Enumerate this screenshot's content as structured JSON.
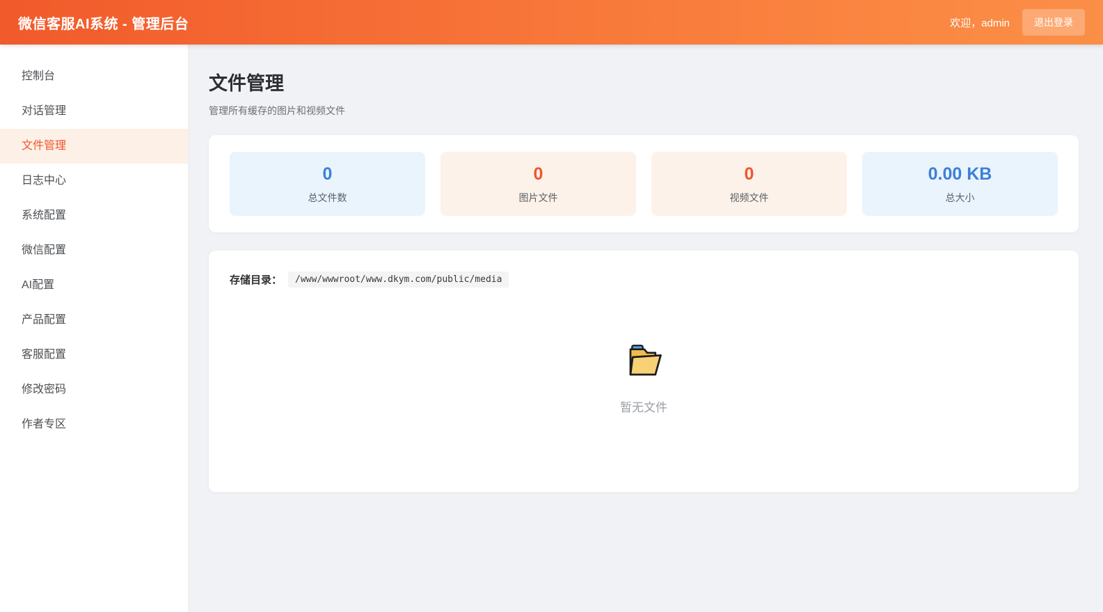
{
  "header": {
    "title": "微信客服AI系统 - 管理后台",
    "welcome": "欢迎，admin",
    "logout_label": "退出登录"
  },
  "sidebar": {
    "items": [
      {
        "label": "控制台",
        "active": false
      },
      {
        "label": "对话管理",
        "active": false
      },
      {
        "label": "文件管理",
        "active": true
      },
      {
        "label": "日志中心",
        "active": false
      },
      {
        "label": "系统配置",
        "active": false
      },
      {
        "label": "微信配置",
        "active": false
      },
      {
        "label": "AI配置",
        "active": false
      },
      {
        "label": "产品配置",
        "active": false
      },
      {
        "label": "客服配置",
        "active": false
      },
      {
        "label": "修改密码",
        "active": false
      },
      {
        "label": "作者专区",
        "active": false
      }
    ]
  },
  "page": {
    "title": "文件管理",
    "subtitle": "管理所有缓存的图片和视频文件"
  },
  "stats": [
    {
      "value": "0",
      "label": "总文件数",
      "theme": "blue",
      "value_color": "#3d7fd8",
      "bg_color": "#eaf4fd"
    },
    {
      "value": "0",
      "label": "图片文件",
      "theme": "orange",
      "value_color": "#f2552e",
      "bg_color": "#fcf2ea"
    },
    {
      "value": "0",
      "label": "视频文件",
      "theme": "orange",
      "value_color": "#f2552e",
      "bg_color": "#fcf2ea"
    },
    {
      "value": "0.00 KB",
      "label": "总大小",
      "theme": "blue",
      "value_color": "#3d7fd8",
      "bg_color": "#eaf4fd"
    }
  ],
  "storage": {
    "label": "存储目录：",
    "path": "/www/wwwroot/www.dkym.com/public/media"
  },
  "empty_state": {
    "icon": "open-folder-icon",
    "text": "暂无文件"
  },
  "colors": {
    "header_gradient_start": "#f15a2b",
    "header_gradient_end": "#fb8f47",
    "accent_orange": "#f2552a",
    "accent_blue": "#3d7fd8",
    "active_menu_bg": "#fdf0e7",
    "page_bg": "#f0f2f5"
  }
}
